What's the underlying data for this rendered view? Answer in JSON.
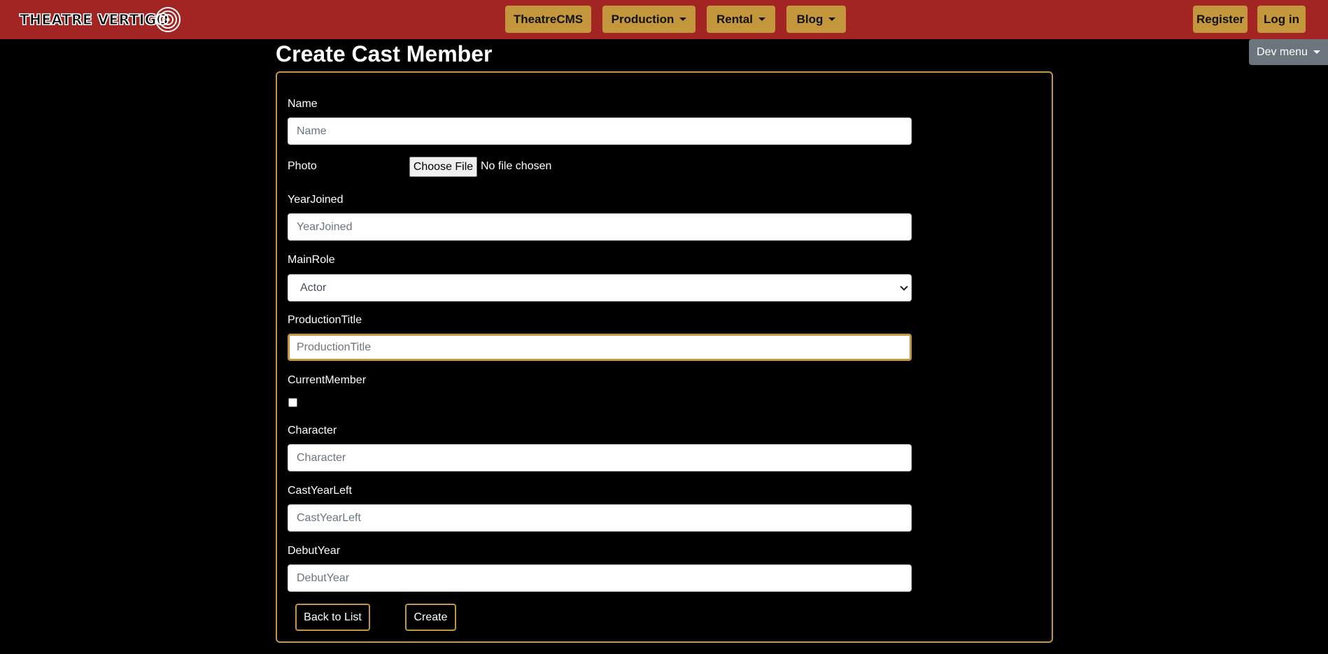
{
  "navbar": {
    "brand": "THEATRE VERTIGO",
    "items": [
      {
        "label": "TheatreCMS",
        "dropdown": false
      },
      {
        "label": "Production",
        "dropdown": true
      },
      {
        "label": "Rental",
        "dropdown": true
      },
      {
        "label": "Blog",
        "dropdown": true
      }
    ],
    "register": "Register",
    "login": "Log in",
    "dev_menu": "Dev menu"
  },
  "page": {
    "title": "Create Cast Member"
  },
  "form": {
    "name": {
      "label": "Name",
      "placeholder": "Name"
    },
    "photo": {
      "label": "Photo",
      "button": "Choose File",
      "status": "No file chosen"
    },
    "year_joined": {
      "label": "YearJoined",
      "placeholder": "YearJoined"
    },
    "main_role": {
      "label": "MainRole",
      "selected": "Actor"
    },
    "production_title": {
      "label": "ProductionTitle",
      "placeholder": "ProductionTitle"
    },
    "current_member": {
      "label": "CurrentMember",
      "checked": false
    },
    "character": {
      "label": "Character",
      "placeholder": "Character"
    },
    "cast_year_left": {
      "label": "CastYearLeft",
      "placeholder": "CastYearLeft"
    },
    "debut_year": {
      "label": "DebutYear",
      "placeholder": "DebutYear"
    },
    "back_button": "Back to List",
    "create_button": "Create"
  },
  "colors": {
    "navbar_bg": "#a32523",
    "accent": "#c4973d",
    "background": "#000000"
  }
}
